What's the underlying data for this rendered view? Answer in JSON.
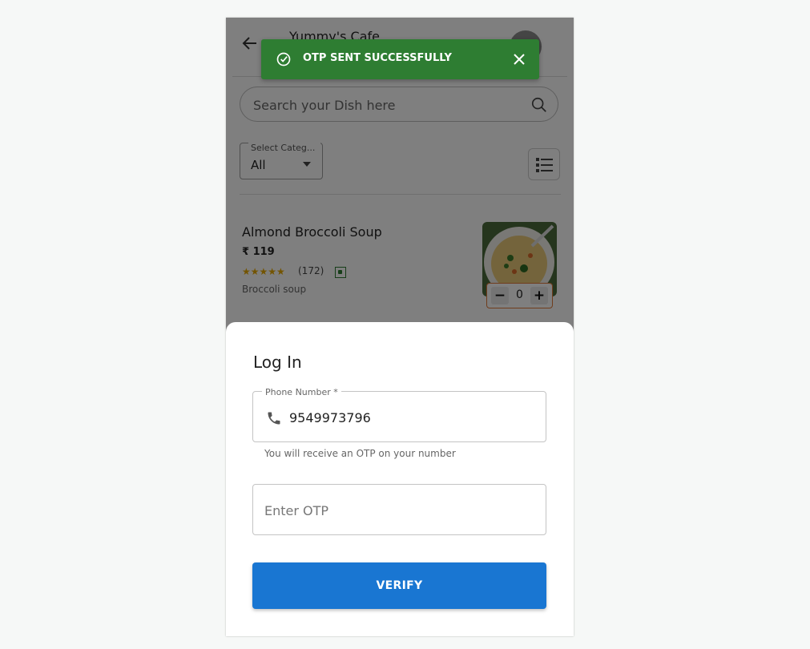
{
  "header": {
    "cafe_name": "Yummy's Cafe"
  },
  "search": {
    "placeholder": "Search your Dish here"
  },
  "category": {
    "label": "Select Categ...",
    "value": "All"
  },
  "dish": {
    "name": "Almond Broccoli Soup",
    "price": "₹ 119",
    "stars": "★★★★★",
    "rating_count": "(172)",
    "description": "Broccoli soup",
    "quantity": "0",
    "minus_label": "−",
    "plus_label": "+"
  },
  "toast": {
    "message": "OTP SENT SUCCESSFULLY",
    "color": "#2e7d32"
  },
  "login": {
    "title": "Log In",
    "phone_label": "Phone Number *",
    "phone_value": "9549973796",
    "helper": "You will receive an OTP on your number",
    "otp_placeholder": "Enter OTP",
    "verify_label": "VERIFY",
    "accent": "#1976d2"
  }
}
